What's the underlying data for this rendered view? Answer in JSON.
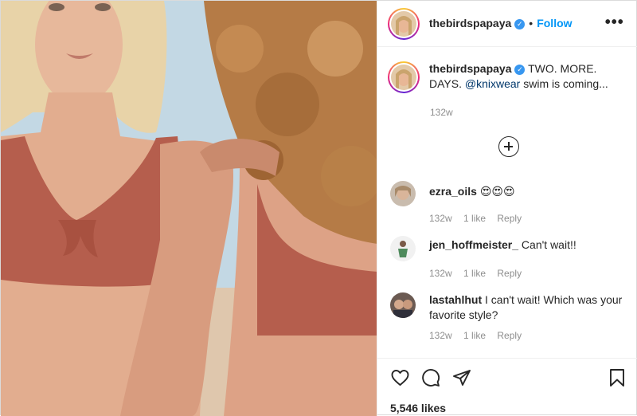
{
  "post": {
    "username": "thebirdspapaya",
    "verified_mark": "✓",
    "separator": "•",
    "follow_label": "Follow",
    "more_label": "•••",
    "caption": {
      "text": "TWO. MORE. DAYS.",
      "mention": "@knixwear",
      "text_after": " swim is coming...",
      "time": "132w"
    },
    "likes": "5,546 likes"
  },
  "comments": [
    {
      "username": "ezra_oils",
      "text": " 😍😍😍",
      "time": "132w",
      "likes": "1 like",
      "reply": "Reply"
    },
    {
      "username": "jen_hoffmeister_",
      "text": " Can't wait!!",
      "time": "132w",
      "likes": "1 like",
      "reply": "Reply"
    },
    {
      "username": "lastahlhut",
      "text": " I can't wait! Which was your favorite style?",
      "time": "132w",
      "likes": "1 like",
      "reply": "Reply"
    }
  ],
  "icons": {
    "load_more": "plus-circle-icon",
    "like": "heart-icon",
    "comment": "speech-bubble-icon",
    "share": "paper-plane-icon",
    "save": "bookmark-icon",
    "more": "ellipsis-icon"
  },
  "colors": {
    "link_blue": "#0095f6",
    "mention_blue": "#00376b",
    "muted": "#8e8e8e",
    "text": "#262626",
    "verified": "#3897f0"
  }
}
